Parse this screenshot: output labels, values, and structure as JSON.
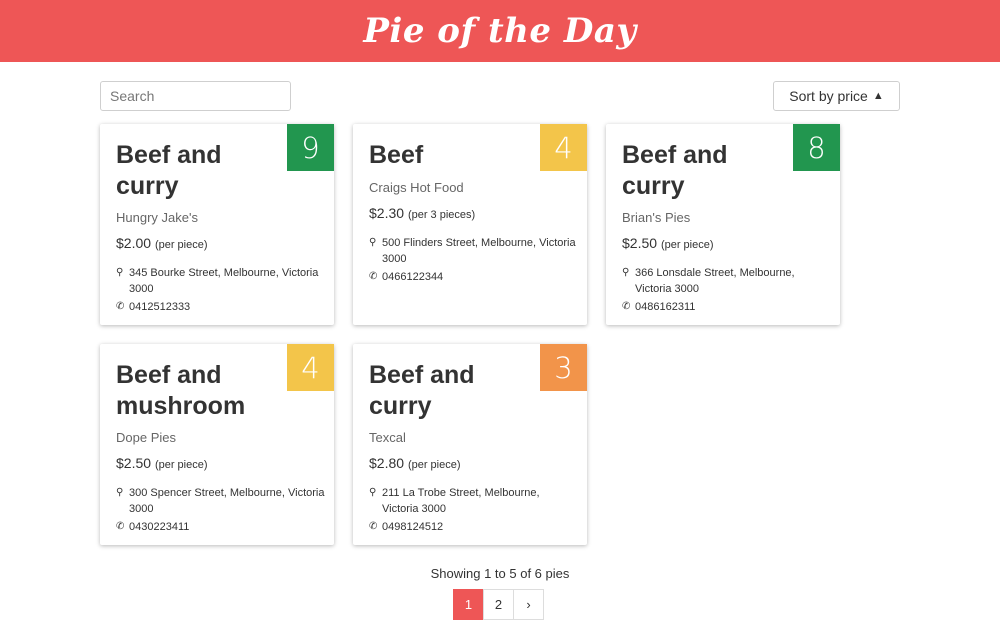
{
  "header": {
    "brand": "Pie of the Day"
  },
  "controls": {
    "search_placeholder": "Search",
    "sort_label": "Sort by price"
  },
  "cards": [
    {
      "rating": "9",
      "rating_color": "#22964f",
      "title": "Beef and curry",
      "shop": "Hungry Jake's",
      "price": "$2.00",
      "unit": "(per piece)",
      "address": "345 Bourke Street, Melbourne, Victoria 3000",
      "phone": "0412512333"
    },
    {
      "rating": "4",
      "rating_color": "#f3c54a",
      "title": "Beef",
      "shop": "Craigs Hot Food",
      "price": "$2.30",
      "unit": "(per 3 pieces)",
      "address": "500 Flinders Street, Melbourne, Victoria 3000",
      "phone": "0466122344"
    },
    {
      "rating": "8",
      "rating_color": "#22964f",
      "title": "Beef and curry",
      "shop": "Brian's Pies",
      "price": "$2.50",
      "unit": "(per piece)",
      "address": "366 Lonsdale Street, Melbourne, Victoria 3000",
      "phone": "0486162311"
    },
    {
      "rating": "4",
      "rating_color": "#f3c54a",
      "title": "Beef and mushroom",
      "shop": "Dope Pies",
      "price": "$2.50",
      "unit": "(per piece)",
      "address": "300 Spencer Street, Melbourne, Victoria 3000",
      "phone": "0430223411"
    },
    {
      "rating": "3",
      "rating_color": "#f2944a",
      "title": "Beef and curry",
      "shop": "Texcal",
      "price": "$2.80",
      "unit": "(per piece)",
      "address": "211 La Trobe Street, Melbourne, Victoria 3000",
      "phone": "0498124512"
    }
  ],
  "footer": {
    "showing": "Showing 1 to 5 of 6 pies"
  },
  "pagination": {
    "pages": [
      "1",
      "2"
    ],
    "next": "›",
    "active": "1"
  },
  "icons": {
    "sort": "triangle-up-icon",
    "address": "map-marker-icon",
    "phone": "phone-icon",
    "next": "chevron-right-icon"
  },
  "colors": {
    "brand": "#ee5656"
  }
}
